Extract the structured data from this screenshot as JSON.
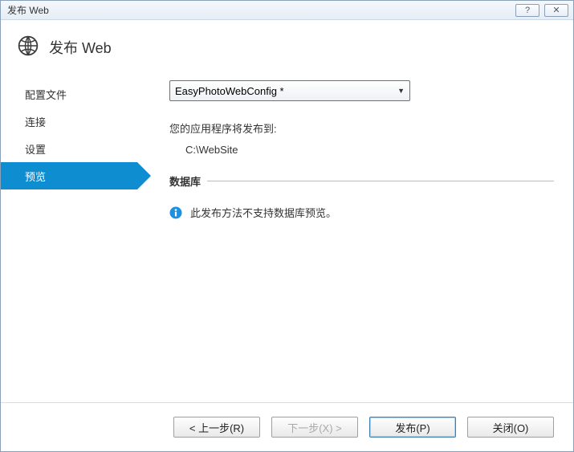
{
  "titlebar": {
    "text": "发布 Web"
  },
  "header": {
    "title": "发布 Web"
  },
  "sidebar": {
    "items": [
      {
        "label": "配置文件"
      },
      {
        "label": "连接"
      },
      {
        "label": "设置"
      },
      {
        "label": "预览"
      }
    ],
    "active_index": 3
  },
  "main": {
    "profile_select": {
      "value": "EasyPhotoWebConfig *"
    },
    "publish_to_label": "您的应用程序将发布到:",
    "publish_path": "C:\\WebSite",
    "db_section_title": "数据库",
    "db_info_text": "此发布方法不支持数据库预览。"
  },
  "footer": {
    "prev_label": "< 上一步(R)",
    "next_label": "下一步(X) >",
    "publish_label": "发布(P)",
    "close_label": "关闭(O)"
  }
}
